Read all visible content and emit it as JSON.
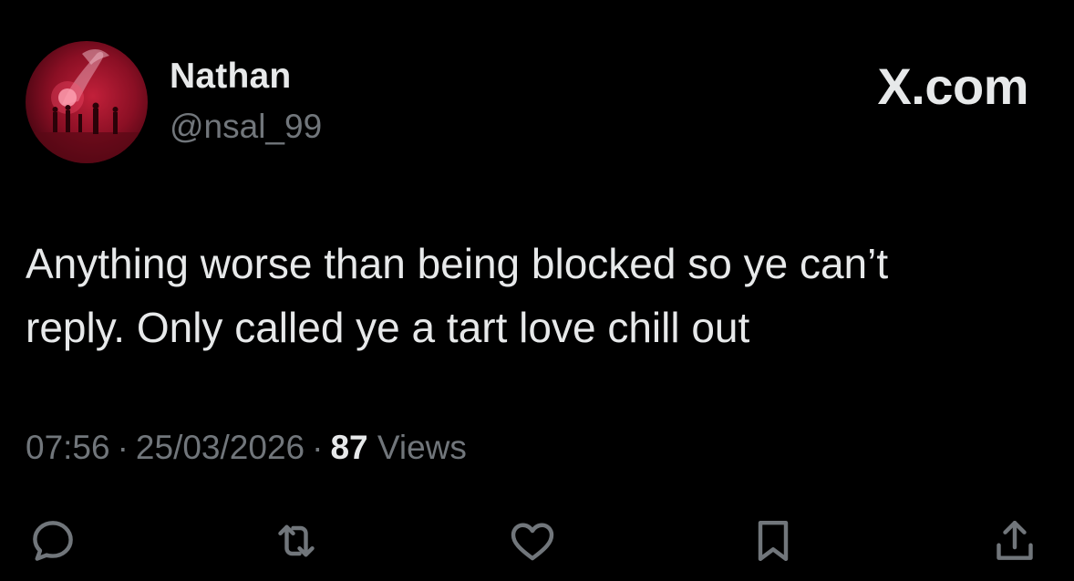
{
  "tweet": {
    "author": {
      "display_name": "Nathan",
      "handle": "@nsal_99"
    },
    "brand": "X.com",
    "text_line1": "Anything worse than being blocked so ye can’t",
    "text_line2": "reply. Only called ye a tart love chill out",
    "time": "07:56",
    "separator": "·",
    "date": "25/03/2026",
    "views_count": "87",
    "views_label": "Views"
  },
  "icons": {
    "reply": "reply-icon",
    "retweet": "retweet-icon",
    "like": "like-icon",
    "bookmark": "bookmark-icon",
    "share": "share-icon"
  },
  "colors": {
    "background": "#000000",
    "primary_text": "#e7e9ea",
    "secondary_text": "#71767b",
    "avatar_accent": "#c2203a"
  }
}
